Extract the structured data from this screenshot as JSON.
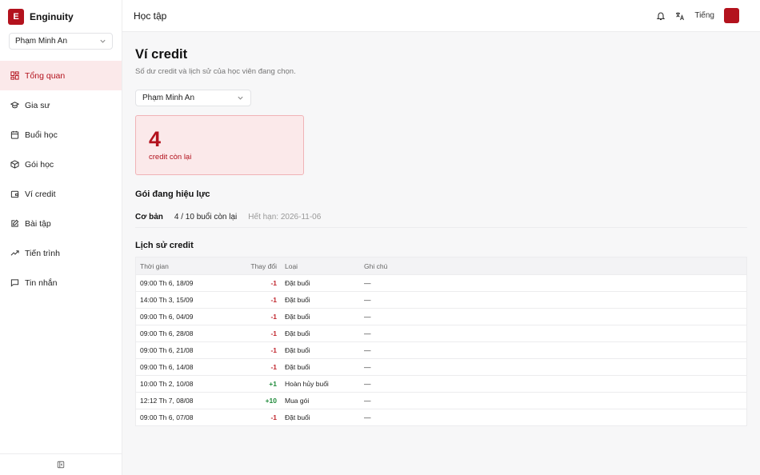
{
  "brand": {
    "logo_letter": "E",
    "name": "Enginuity"
  },
  "sidebar": {
    "student": "Phạm Minh An",
    "items": [
      {
        "label": "Tổng quan",
        "icon": "dashboard-icon",
        "active": true
      },
      {
        "label": "Gia sư",
        "icon": "graduation-cap-icon"
      },
      {
        "label": "Buổi học",
        "icon": "calendar-icon"
      },
      {
        "label": "Gói học",
        "icon": "package-icon"
      },
      {
        "label": "Ví credit",
        "icon": "wallet-icon"
      },
      {
        "label": "Bài tập",
        "icon": "edit-icon"
      },
      {
        "label": "Tiến trình",
        "icon": "trending-icon"
      },
      {
        "label": "Tin nhắn",
        "icon": "message-icon"
      }
    ],
    "collapse_icon": "sidebar-collapse-icon"
  },
  "topbar": {
    "title": "Học tập",
    "lang": "Tiếng",
    "user_initial": "",
    "user_name": ""
  },
  "page": {
    "title": "Ví credit",
    "subtitle": "Số dư credit và lịch sử của học viên đang chọn.",
    "student_filter": "Phạm Minh An",
    "credit": {
      "value": "4",
      "label": "credit còn lại"
    },
    "package_section": "Gói đang hiệu lực",
    "package": {
      "name": "Cơ bản",
      "remaining": "4 / 10 buổi còn lại",
      "expiry": "Hết hạn: 2026-11-06"
    },
    "history_section": "Lịch sử credit",
    "table": {
      "headers": {
        "time": "Thời gian",
        "change": "Thay đổi",
        "type": "Loại",
        "note": "Ghi chú"
      },
      "rows": [
        {
          "time": "09:00 Th 6, 18/09",
          "change": "-1",
          "type": "Đặt buổi",
          "note": "—"
        },
        {
          "time": "14:00 Th 3, 15/09",
          "change": "-1",
          "type": "Đặt buổi",
          "note": "—"
        },
        {
          "time": "09:00 Th 6, 04/09",
          "change": "-1",
          "type": "Đặt buổi",
          "note": "—"
        },
        {
          "time": "09:00 Th 6, 28/08",
          "change": "-1",
          "type": "Đặt buổi",
          "note": "—"
        },
        {
          "time": "09:00 Th 6, 21/08",
          "change": "-1",
          "type": "Đặt buổi",
          "note": "—"
        },
        {
          "time": "09:00 Th 6, 14/08",
          "change": "-1",
          "type": "Đặt buổi",
          "note": "—"
        },
        {
          "time": "10:00 Th 2, 10/08",
          "change": "+1",
          "type": "Hoàn hủy buổi",
          "note": "—"
        },
        {
          "time": "12:12 Th 7, 08/08",
          "change": "+10",
          "type": "Mua gói",
          "note": "—"
        },
        {
          "time": "09:00 Th 6, 07/08",
          "change": "-1",
          "type": "Đặt buổi",
          "note": "—"
        }
      ]
    }
  },
  "colors": {
    "accent": "#b3121d",
    "accent_bg": "#fbe9ea",
    "negative": "#c0262d",
    "positive": "#1f8a3a"
  }
}
